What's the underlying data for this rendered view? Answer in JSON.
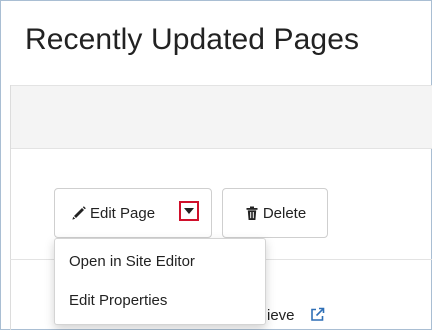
{
  "panel": {
    "title": "Recently Updated Pages"
  },
  "toolbar": {
    "edit_label": "Edit Page",
    "delete_label": "Delete"
  },
  "dropdown": {
    "items": [
      {
        "label": "Open in Site Editor"
      },
      {
        "label": "Edit Properties"
      }
    ]
  },
  "row": {
    "visible_text": "ieve"
  },
  "colors": {
    "highlight_border": "#d0102b",
    "link_blue": "#2f6fb6",
    "frame_border": "#a9bed3"
  },
  "icons": {
    "edit": "pencil-icon",
    "delete": "trash-icon",
    "dropdown": "caret-down-icon",
    "external": "external-link-icon"
  }
}
